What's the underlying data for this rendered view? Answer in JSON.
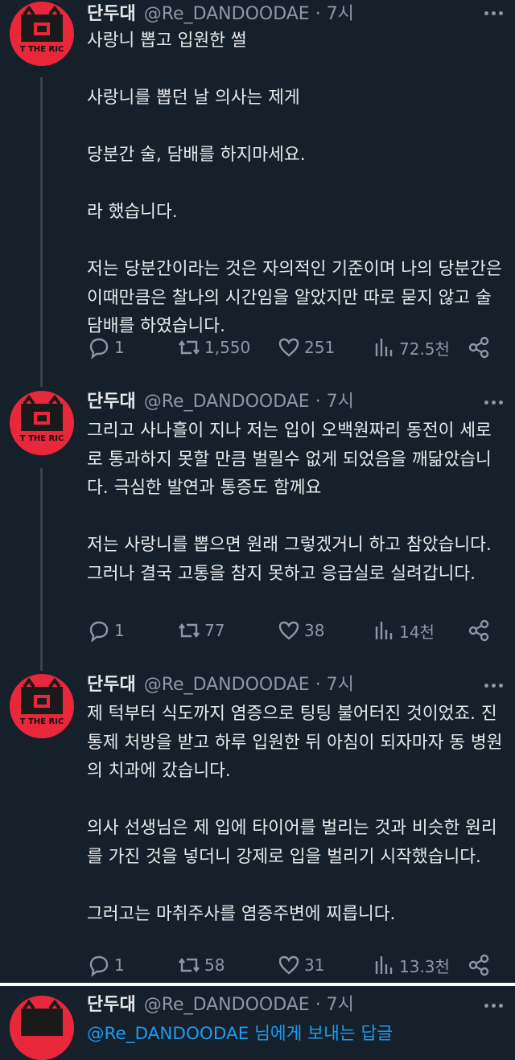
{
  "author": {
    "name": "단두대",
    "handle_time": "@Re_DANDOODAE · 7시",
    "avatar_text": "T THE RIC"
  },
  "tweets": [
    {
      "text": "사랑니 뽑고 입원한 썰\n\n사랑니를 뽑던 날 의사는 제게\n\n당분간 술, 담배를 하지마세요.\n\n라 했습니다.\n\n저는 당분간이라는 것은 자의적인 기준이며 나의 당분간은 이때만큼은 찰나의 시간임을 알았지만 따로 묻지 않고 술 담배를 하였습니다.",
      "replies": "1",
      "retweets": "1,550",
      "likes": "251",
      "views": "72.5천"
    },
    {
      "text": "그리고 사나흘이 지나 저는 입이 오백원짜리 동전이 세로로 통과하지 못할 만큼 벌릴수 없게 되었음을 깨닮았습니다. 극심한 발연과 통증도 함께요\n\n저는 사랑니를 뽑으면 원래 그렇겠거니 하고 참았습니다. 그러나 결국 고통을 참지 못하고 응급실로 실려갑니다.",
      "replies": "1",
      "retweets": "77",
      "likes": "38",
      "views": "14천"
    },
    {
      "text": "제 턱부터 식도까지 염증으로 팅팅 불어터진 것이었죠. 진통제 처방을 받고 하루 입원한 뒤 아침이 되자마자 동 병원의 치과에 갔습니다.\n\n의사 선생님은 제 입에 타이어를 벌리는 것과 비슷한 원리를 가진 것을 넣더니 강제로 입을 벌리기 시작했습니다.\n\n그러고는 마취주사를 염증주변에 찌릅니다.",
      "replies": "1",
      "retweets": "58",
      "likes": "31",
      "views": "13.3천"
    }
  ],
  "partial_tweet": {
    "reply_text": "@Re_DANDOODAE 님에게 보내는 답글"
  },
  "colors": {
    "background": "#15202b",
    "text": "#e7e9ea",
    "muted": "#8b98a5",
    "avatar_red": "#e8283a",
    "link": "#1d9bf0"
  }
}
